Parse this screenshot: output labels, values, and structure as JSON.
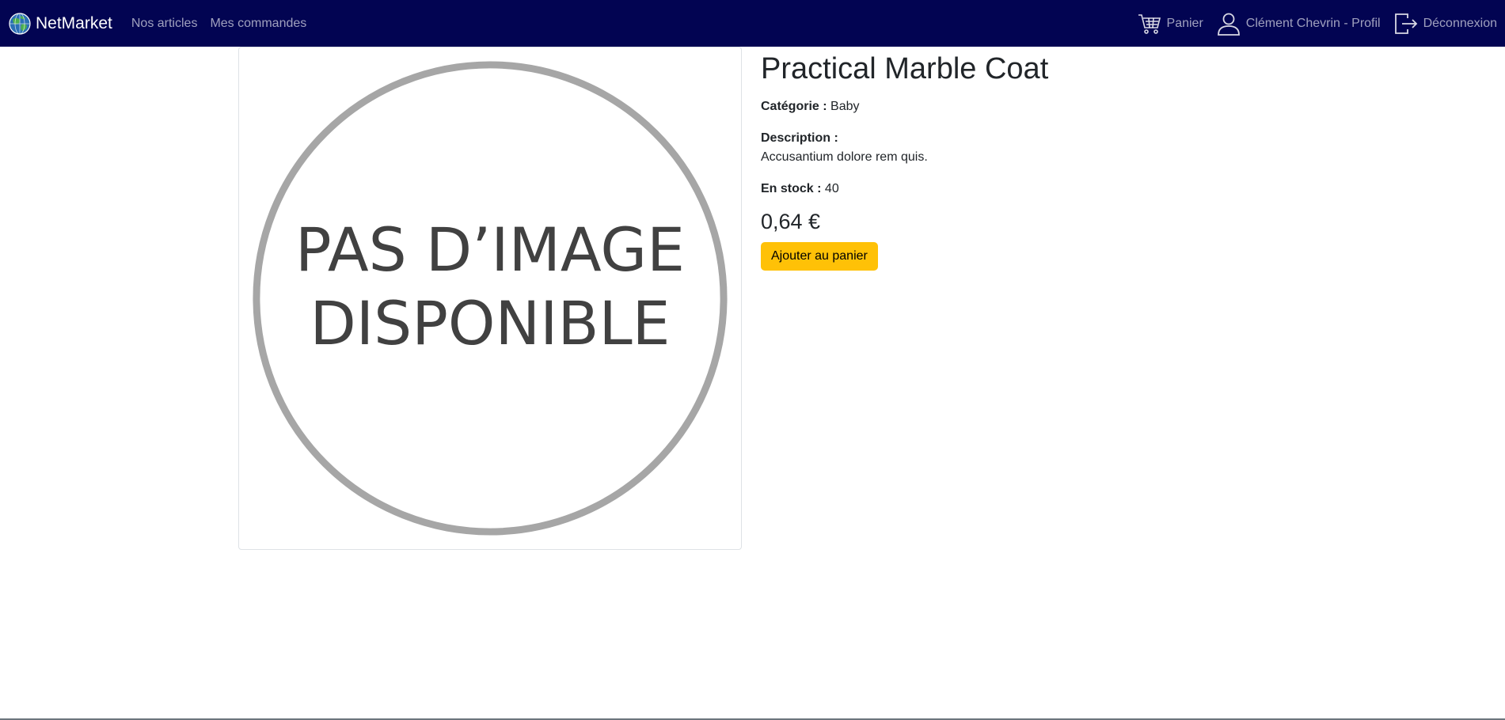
{
  "navbar": {
    "brand": "NetMarket",
    "links": {
      "articles": "Nos articles",
      "orders": "Mes commandes"
    },
    "cart": "Panier",
    "profile": "Clément Chevrin - Profil",
    "logout": "Déconnexion",
    "background_color": "#020452",
    "icons": [
      "globe-logo-icon",
      "cart-icon",
      "user-icon",
      "logout-icon"
    ]
  },
  "product": {
    "image_placeholder": {
      "line1": "PAS D’IMAGE",
      "line2": "DISPONIBLE"
    },
    "title": "Practical Marble Coat",
    "category_label": "Catégorie :",
    "category": "Baby",
    "description_label": "Description :",
    "description": "Accusantium dolore rem quis.",
    "stock_label": "En stock :",
    "stock": "40",
    "price": "0,64 €",
    "add_to_cart": "Ajouter au panier",
    "button_color": "#ffc107"
  }
}
